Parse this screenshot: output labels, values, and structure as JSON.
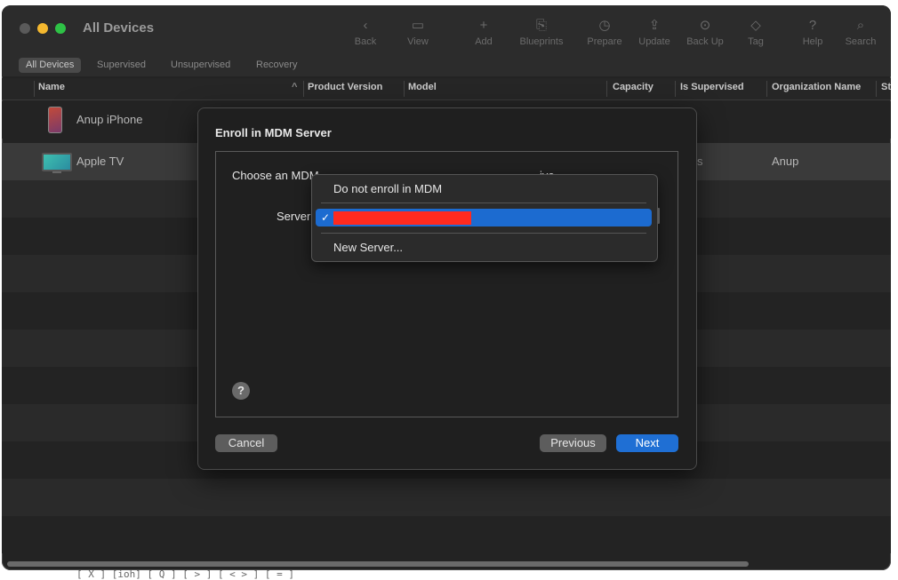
{
  "window": {
    "title": "All Devices"
  },
  "toolbar": [
    {
      "label": "Back",
      "icon": "chevron-left-icon",
      "glyph": "‹"
    },
    {
      "label": "View",
      "icon": "view-icon",
      "glyph": "▭"
    },
    {
      "label": "Add",
      "icon": "plus-icon",
      "glyph": "+"
    },
    {
      "label": "Blueprints",
      "icon": "blueprints-icon",
      "glyph": "⎘"
    },
    {
      "label": "Prepare",
      "icon": "prepare-icon",
      "glyph": "◷"
    },
    {
      "label": "Update",
      "icon": "update-icon",
      "glyph": "⇪"
    },
    {
      "label": "Back Up",
      "icon": "backup-icon",
      "glyph": "⊙"
    },
    {
      "label": "Tag",
      "icon": "tag-icon",
      "glyph": "◇"
    },
    {
      "label": "Help",
      "icon": "help-icon",
      "glyph": "?"
    },
    {
      "label": "Search",
      "icon": "search-icon",
      "glyph": "⌕"
    }
  ],
  "filters": [
    "All Devices",
    "Supervised",
    "Unsupervised",
    "Recovery"
  ],
  "columns": [
    "Name",
    "Product Version",
    "Model",
    "Capacity",
    "Is Supervised",
    "Organization Name",
    "St"
  ],
  "sort_indicator": "^",
  "devices": [
    {
      "name": "Anup iPhone",
      "organization": ""
    },
    {
      "name": "Apple TV",
      "organization": "Anup",
      "supervised_fragment": "s"
    }
  ],
  "dialog": {
    "title": "Enroll in MDM Server",
    "description": "Choose an MDM",
    "description_tail": "ive",
    "server_label": "Server",
    "help": "?",
    "buttons": {
      "cancel": "Cancel",
      "previous": "Previous",
      "next": "Next"
    }
  },
  "dropdown": {
    "items": [
      "Do not enroll in MDM",
      "",
      "New Server..."
    ],
    "check": "✓"
  },
  "footer_fragment": "[ X ]  [ioh] [ Q ] [ > ] [ < > ] [ = ]",
  "colors": {
    "accent": "#1f6fd4",
    "selection": "#1c6bd0",
    "redaction": "#ff2a1f"
  }
}
